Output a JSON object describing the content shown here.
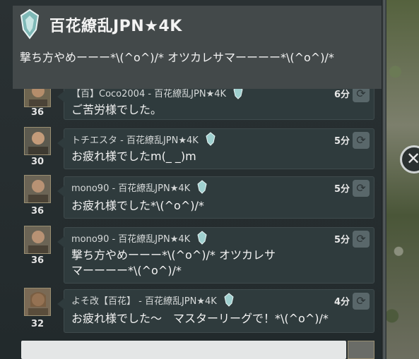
{
  "header": {
    "title": "百花繚乱JPN★4K",
    "pinned_message": "撃ち方やめーーー*\\(^o^)/* オツカレサマーーーー*\\(^o^)/*",
    "emblem_icon": "alliance-emblem-icon"
  },
  "messages": [
    {
      "level": "36",
      "sender": "【百】Coco2004 - 百花繚乱JPN★4K",
      "time": "6分",
      "text_lines": [
        "ご苦労様でした。"
      ]
    },
    {
      "level": "30",
      "sender": "トチエスタ - 百花繚乱JPN★4K",
      "time": "5分",
      "text_lines": [
        "お疲れ様でしたm(_ _)m"
      ]
    },
    {
      "level": "36",
      "sender": "mono90 - 百花繚乱JPN★4K",
      "time": "5分",
      "text_lines": [
        "お疲れ様でした*\\(^o^)/*"
      ]
    },
    {
      "level": "36",
      "sender": "mono90 - 百花繚乱JPN★4K",
      "time": "5分",
      "text_lines": [
        "撃ち方やめーーー*\\(^o^)/* オツカレサ",
        "マーーーー*\\(^o^)/*"
      ]
    },
    {
      "level": "32",
      "sender": "よそ改【百花】 - 百花繚乱JPN★4K",
      "time": "4分",
      "text_lines": [
        "お疲れ様でした〜　マスターリーグで！*\\(^o^)/*"
      ]
    }
  ],
  "colors": {
    "panel_bg": "#222a2c",
    "header_bg": "#43494a",
    "bubble_bg": "#2f3b3d",
    "text": "#f3f3f3"
  }
}
